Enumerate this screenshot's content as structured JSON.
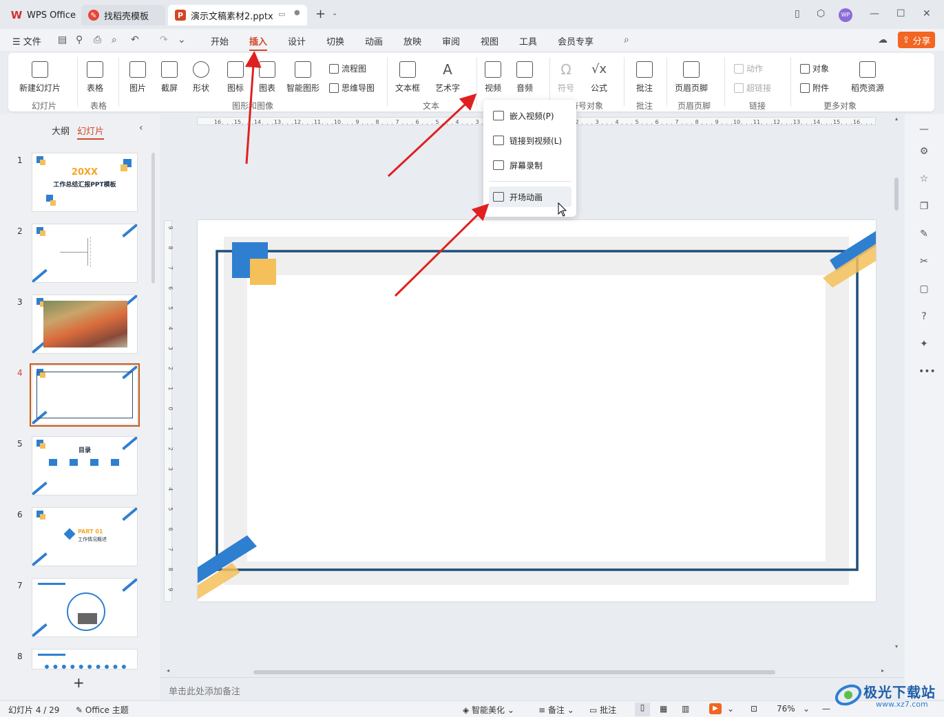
{
  "titlebar": {
    "tabs": [
      {
        "label": "WPS Office"
      },
      {
        "label": "找稻壳模板"
      },
      {
        "label": "演示文稿素材2.pptx"
      }
    ]
  },
  "menubar": {
    "file": "文件",
    "items": [
      "开始",
      "插入",
      "设计",
      "切换",
      "动画",
      "放映",
      "审阅",
      "视图",
      "工具",
      "会员专享"
    ],
    "active": "插入",
    "share": "分享"
  },
  "ribbon": {
    "new_slide": "新建幻灯片",
    "table": "表格",
    "picture": "图片",
    "screenshot": "截屏",
    "shape": "形状",
    "icon": "图标",
    "chart": "图表",
    "smart_graphic": "智能图形",
    "flowchart": "流程图",
    "mindmap": "思维导图",
    "textbox": "文本框",
    "wordart": "艺术字",
    "video": "视频",
    "audio": "音频",
    "symbol": "符号",
    "formula": "公式",
    "comment": "批注",
    "header_footer": "页眉页脚",
    "action": "动作",
    "hyperlink": "超链接",
    "object": "对象",
    "attachment": "附件",
    "docer": "稻壳资源",
    "groups": {
      "slides": "幻灯片",
      "table": "表格",
      "graphics": "图形和图像",
      "text": "文本",
      "symbols": "符号对象",
      "comment": "批注",
      "header_footer": "页眉页脚",
      "link": "链接",
      "more": "更多对象"
    }
  },
  "video_menu": {
    "items": [
      {
        "label": "嵌入视频(P)"
      },
      {
        "label": "链接到视频(L)"
      },
      {
        "label": "屏幕录制"
      },
      {
        "label": "开场动画"
      }
    ]
  },
  "left_panel": {
    "tab_outline": "大纲",
    "tab_slides": "幻灯片",
    "slide1_title": "20XX",
    "slide1_subtitle": "工作总结汇报PPT模板",
    "slide5_title": "目录",
    "slide6_part": "PART 01",
    "slide6_title": "工作情况概述",
    "slide_numbers": [
      "1",
      "2",
      "3",
      "4",
      "5",
      "6",
      "7",
      "8"
    ],
    "selected_slide": 4
  },
  "notes": {
    "placeholder": "单击此处添加备注"
  },
  "statusbar": {
    "slide_count": "幻灯片 4 / 29",
    "theme": "Office 主题",
    "smart_beautify": "智能美化",
    "notes": "备注",
    "comments": "批注",
    "zoom": "76%"
  },
  "watermark": {
    "text": "极光下载站",
    "url_text": "www.xz7.com"
  },
  "colors": {
    "accent": "#d24726",
    "share": "#f26522",
    "slide_blue": "#2f7fd0",
    "slide_yellow": "#f5bf5a",
    "frame_navy": "#1f4e79"
  }
}
